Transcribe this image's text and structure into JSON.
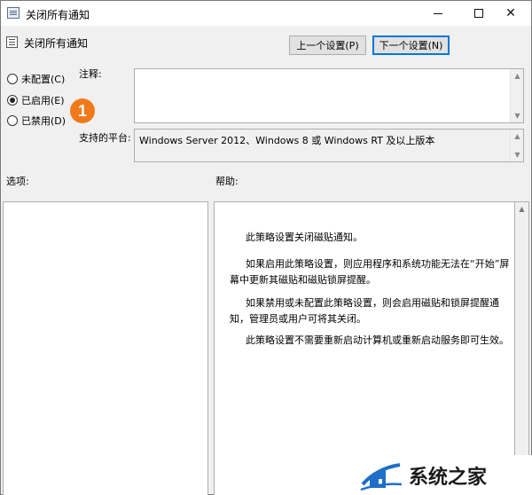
{
  "window": {
    "title": "关闭所有通知"
  },
  "header": {
    "title": "关闭所有通知",
    "prev_button": "上一个设置(P)",
    "next_button": "下一个设置(N)"
  },
  "state": {
    "options": [
      {
        "label": "未配置(C)",
        "selected": false
      },
      {
        "label": "已启用(E)",
        "selected": true
      },
      {
        "label": "已禁用(D)",
        "selected": false
      }
    ]
  },
  "callout": "1",
  "labels": {
    "comment": "注释:",
    "platform": "支持的平台:",
    "options": "选项:",
    "help": "帮助:"
  },
  "fields": {
    "comment_value": "",
    "platform_value": "Windows Server 2012、Windows 8 或 Windows RT 及以上版本"
  },
  "help": {
    "paragraphs": [
      "此策略设置关闭磁贴通知。",
      "如果启用此策略设置，则应用程序和系统功能无法在“开始”屏幕中更新其磁贴和磁贴锁屏提醒。",
      "如果禁用或未配置此策略设置，则会启用磁贴和锁屏提醒通知，管理员或用户可将其关闭。",
      "此策略设置不需要重新启动计算机或重新启动服务即可生效。"
    ]
  },
  "watermark": {
    "text": "系统之家"
  },
  "colors": {
    "callout": "#f07a1a",
    "focus": "#0078d7"
  }
}
